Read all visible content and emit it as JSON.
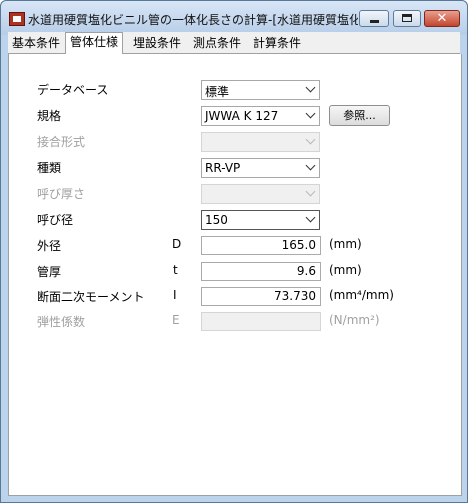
{
  "window": {
    "title": "水道用硬質塩化ビニル管の一体化長さの計算-[水道用硬質塩化..."
  },
  "caption": {
    "close_glyph": "✕"
  },
  "tabs": [
    {
      "label": "基本条件"
    },
    {
      "label": "管体仕様"
    },
    {
      "label": "埋設条件"
    },
    {
      "label": "測点条件"
    },
    {
      "label": "計算条件"
    }
  ],
  "form": {
    "database": {
      "label": "データベース",
      "value": "標準"
    },
    "standard": {
      "label": "規格",
      "value": "JWWA K 127",
      "ref_button": "参照..."
    },
    "joint_type": {
      "label": "接合形式",
      "value": ""
    },
    "kind": {
      "label": "種類",
      "value": "RR-VP"
    },
    "nominal_thickness": {
      "label": "呼び厚さ",
      "value": ""
    },
    "nominal_diameter": {
      "label": "呼び径",
      "value": "150"
    },
    "outer_diameter": {
      "label": "外径",
      "symbol": "D",
      "value": "165.0",
      "unit": "(mm)"
    },
    "thickness": {
      "label": "管厚",
      "symbol": "t",
      "value": "9.6",
      "unit": "(mm)"
    },
    "moment": {
      "label": "断面二次モーメント",
      "symbol": "I",
      "value": "73.730",
      "unit": "(mm⁴/mm)"
    },
    "elastic": {
      "label": "弾性係数",
      "symbol": "E",
      "value": "",
      "unit": "(N/mm²)"
    }
  }
}
